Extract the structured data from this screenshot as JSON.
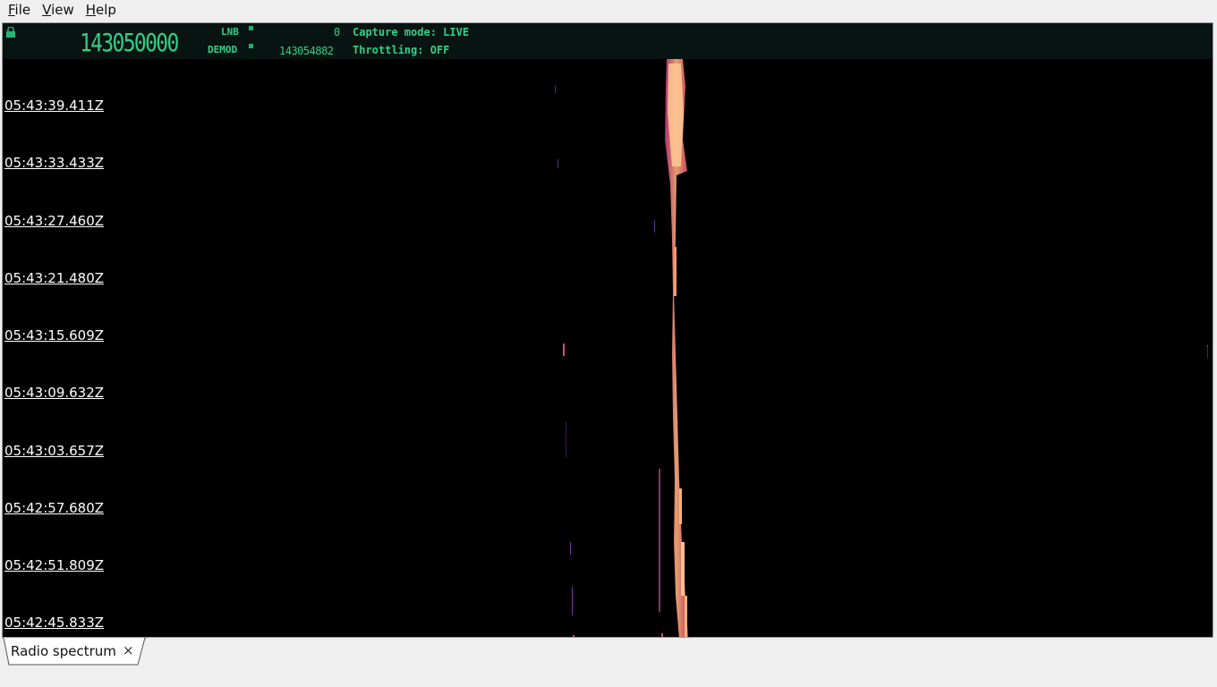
{
  "menubar": {
    "items": [
      {
        "mnemonic": "F",
        "rest": "ile"
      },
      {
        "mnemonic": "V",
        "rest": "iew"
      },
      {
        "mnemonic": "H",
        "rest": "elp"
      }
    ]
  },
  "header": {
    "frequency": "143050000",
    "lnb_label": "LNB",
    "lnb_value": "0",
    "demod_label": "DEMOD",
    "demod_value": "143054882",
    "capture_mode": "Capture mode: LIVE",
    "throttling": "Throttling: OFF",
    "accent_color": "#2fd08a"
  },
  "waterfall": {
    "timestamps": [
      "05:43:39.411Z",
      "05:43:33.433Z",
      "05:43:27.460Z",
      "05:43:21.480Z",
      "05:43:15.609Z",
      "05:43:09.632Z",
      "05:43:03.657Z",
      "05:42:57.680Z",
      "05:42:51.809Z",
      "05:42:45.833Z"
    ]
  },
  "tabs": [
    {
      "label": "Radio spectrum",
      "close_icon": "×"
    }
  ]
}
